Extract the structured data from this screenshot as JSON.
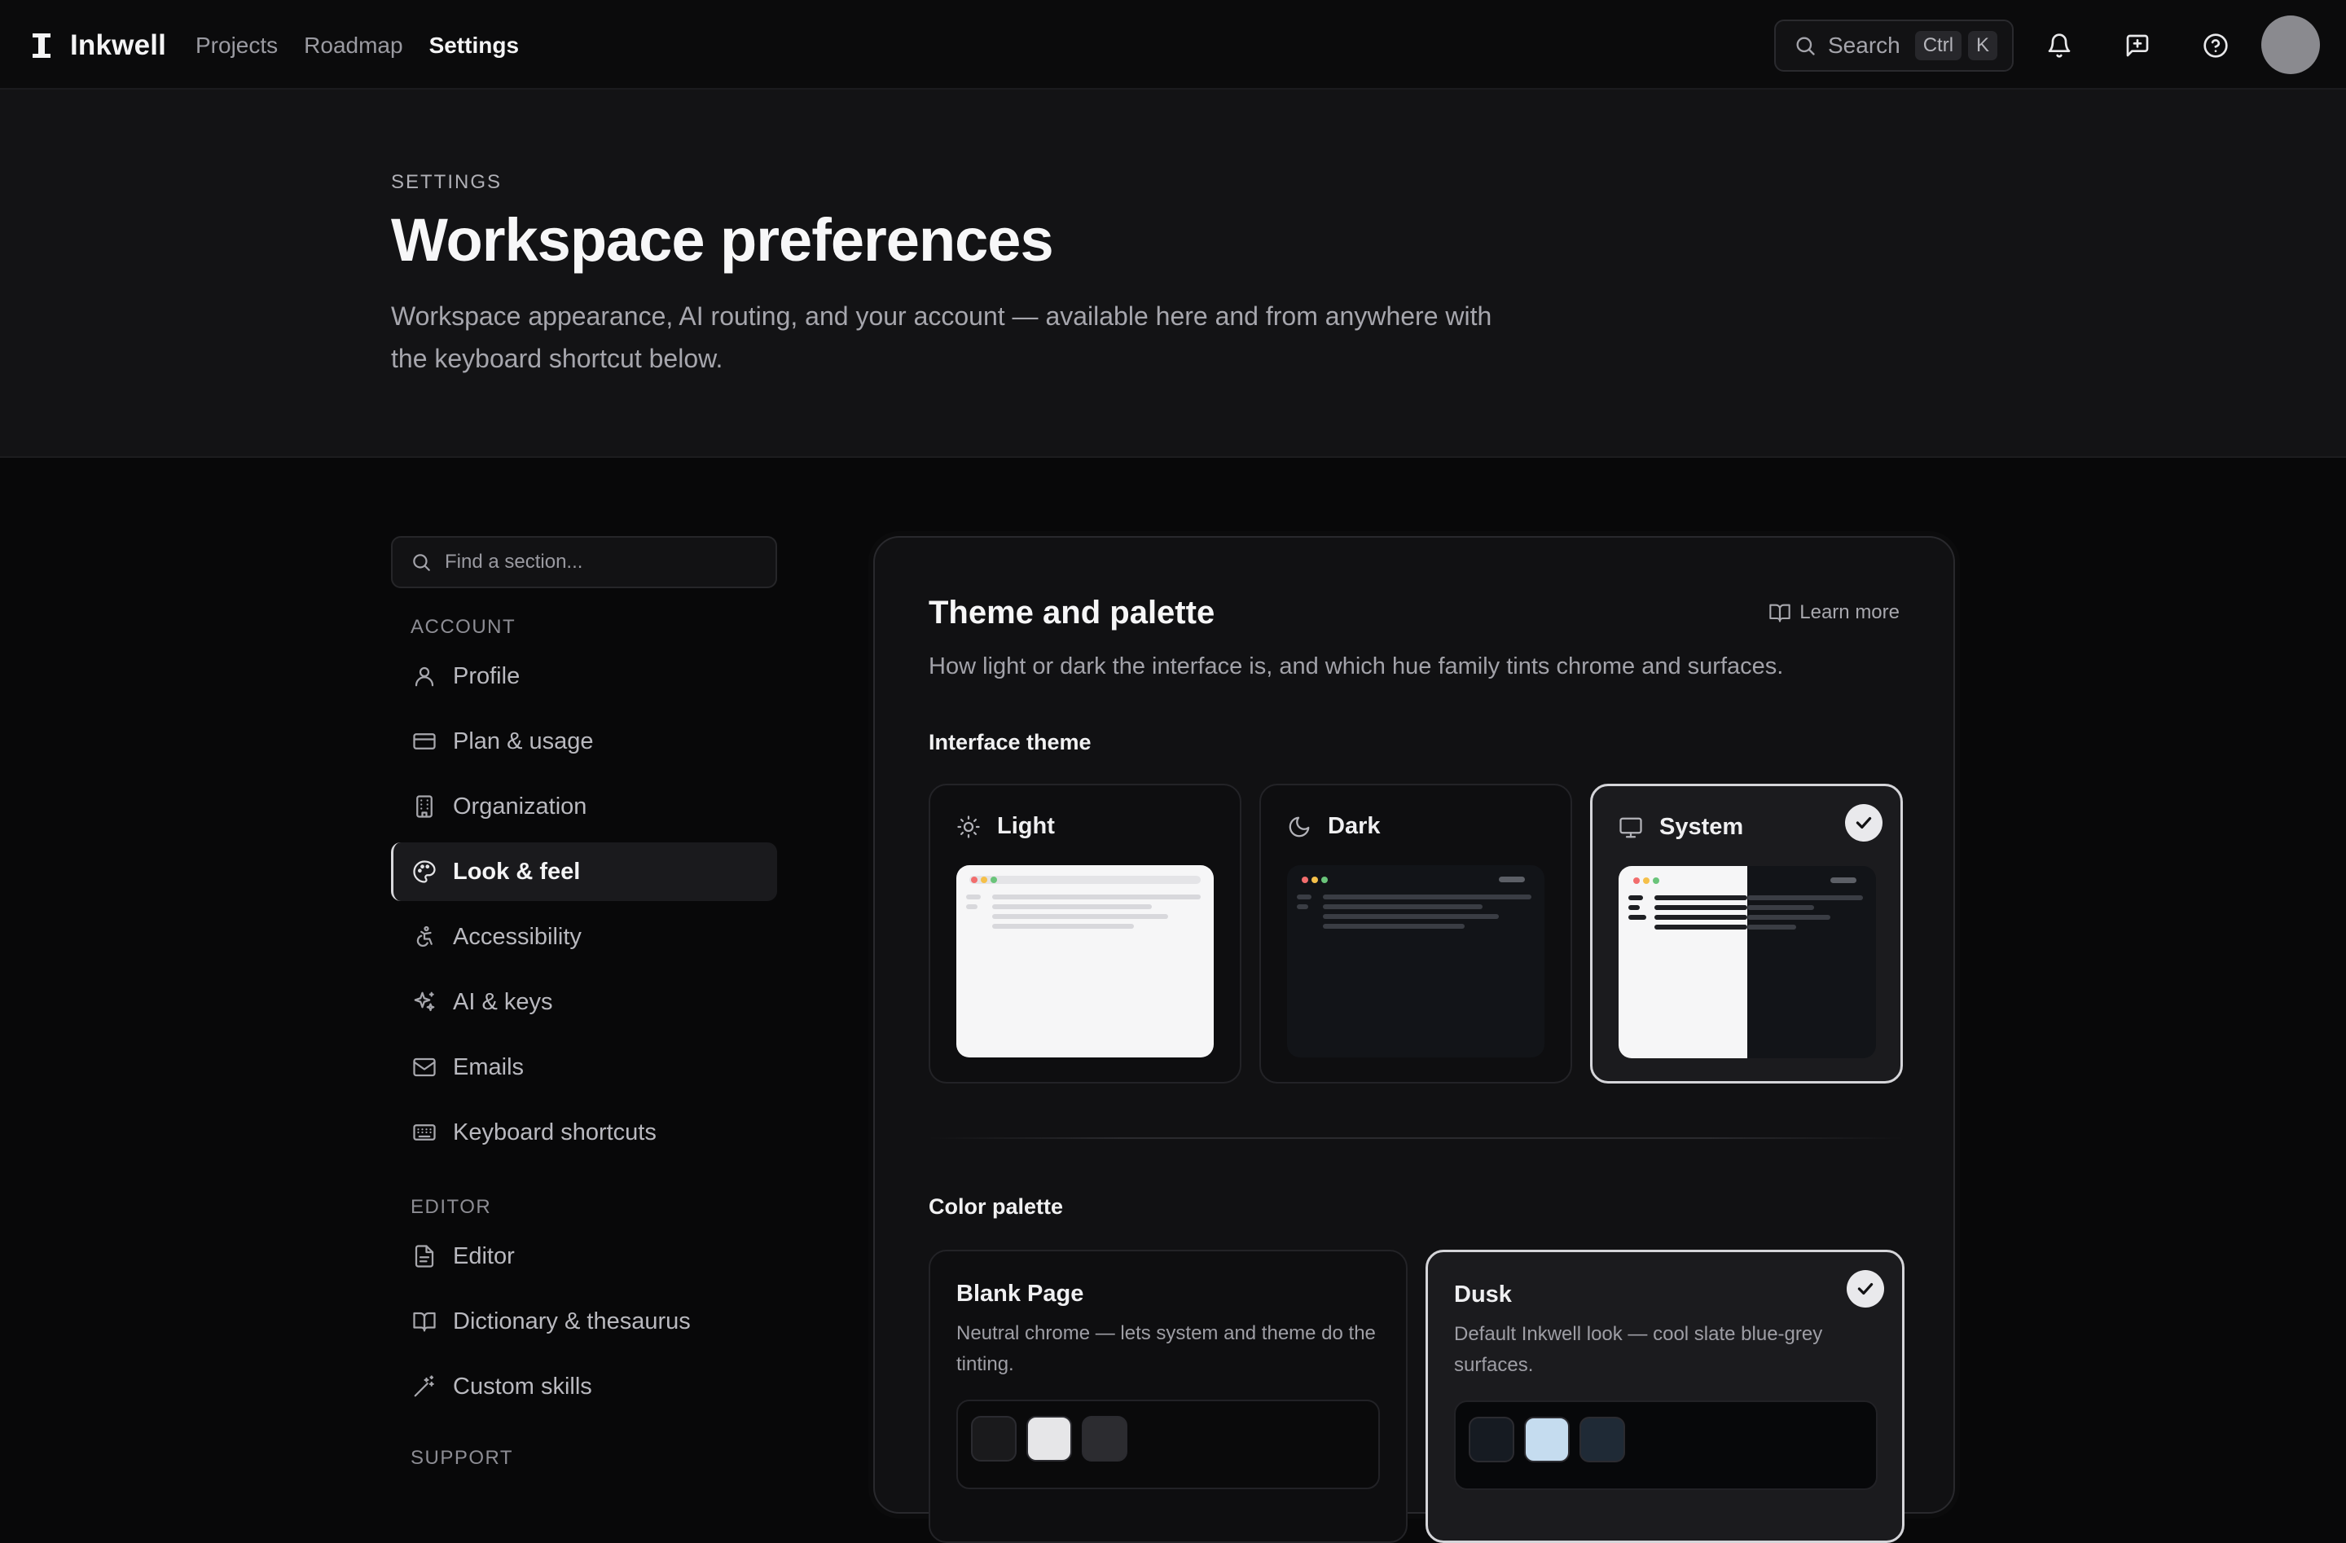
{
  "app": {
    "name": "Inkwell"
  },
  "nav": [
    {
      "label": "Projects",
      "active": false
    },
    {
      "label": "Roadmap",
      "active": false
    },
    {
      "label": "Settings",
      "active": true
    }
  ],
  "search": {
    "label": "Search",
    "kbd": [
      "Ctrl",
      "K"
    ]
  },
  "topbar_icons": [
    "bell-icon",
    "feedback-icon",
    "help-icon"
  ],
  "header": {
    "eyebrow": "SETTINGS",
    "title": "Workspace preferences",
    "subtitle": "Workspace appearance, AI routing, and your account — available here and from anywhere with the keyboard shortcut below."
  },
  "sidebar": {
    "search_placeholder": "Find a section...",
    "sections": [
      {
        "label": "ACCOUNT",
        "items": [
          {
            "label": "Profile",
            "icon": "user-icon"
          },
          {
            "label": "Plan & usage",
            "icon": "credit-card-icon"
          },
          {
            "label": "Organization",
            "icon": "building-icon"
          },
          {
            "label": "Look & feel",
            "icon": "palette-icon",
            "active": true
          },
          {
            "label": "Accessibility",
            "icon": "accessibility-icon"
          },
          {
            "label": "AI & keys",
            "icon": "sparkles-icon"
          },
          {
            "label": "Emails",
            "icon": "mail-icon"
          },
          {
            "label": "Keyboard shortcuts",
            "icon": "keyboard-icon"
          }
        ]
      },
      {
        "label": "EDITOR",
        "items": [
          {
            "label": "Editor",
            "icon": "file-text-icon"
          },
          {
            "label": "Dictionary & thesaurus",
            "icon": "book-open-icon"
          },
          {
            "label": "Custom skills",
            "icon": "wand-icon"
          }
        ]
      },
      {
        "label": "SUPPORT",
        "items": []
      }
    ]
  },
  "panel": {
    "title": "Theme and palette",
    "learn_more": "Learn more",
    "description": "How light or dark the interface is, and which hue family tints chrome and surfaces.",
    "interface_theme": {
      "heading": "Interface theme",
      "options": [
        {
          "label": "Light",
          "icon": "sun-icon",
          "selected": false
        },
        {
          "label": "Dark",
          "icon": "moon-icon",
          "selected": false
        },
        {
          "label": "System",
          "icon": "monitor-icon",
          "selected": true
        }
      ]
    },
    "color_palette": {
      "heading": "Color palette",
      "options": [
        {
          "label": "Blank Page",
          "description": "Neutral chrome — lets system and theme do the tinting.",
          "selected": false,
          "swatches": [
            "#1a1a1c",
            "#e6e6e8",
            "#2c2c30"
          ]
        },
        {
          "label": "Dusk",
          "description": "Default Inkwell look — cool slate blue-grey surfaces.",
          "selected": true,
          "swatches": [
            "#161b22",
            "#c5dcef",
            "#1f2a36"
          ]
        }
      ]
    }
  },
  "colors": {
    "background": "#080809",
    "surface": "#111113",
    "accent": "#e9e9ec"
  }
}
